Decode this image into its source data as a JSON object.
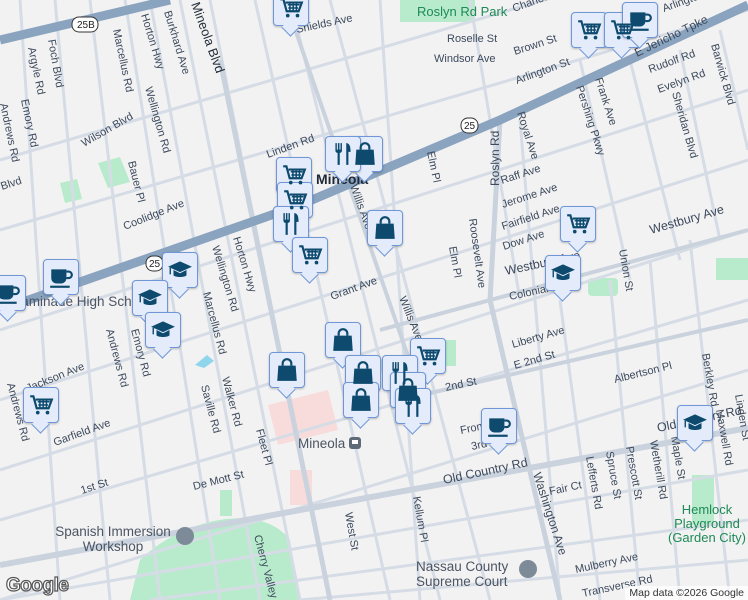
{
  "map": {
    "area_labels": {
      "mineola": "Mineola",
      "mineola_station": "Mineola"
    },
    "parks": [
      "Roslyn Rd Park",
      "Hemlock Playground (Garden City)"
    ],
    "pois": [
      "Chaminade High School",
      "Spanish Immersion Workshop",
      "Nassau County Supreme Court"
    ],
    "route_shields": [
      "25B",
      "25",
      "25",
      "25"
    ],
    "streets": [
      "Foch Blvd",
      "Argyle Rd",
      "Emory Rd",
      "Andrews Rd",
      "Marcellus Rd",
      "Horton Hwy",
      "Burkhard Ave",
      "Mineola Blvd",
      "Wellington Rd",
      "Wilson Blvd",
      "Bauer Pl",
      "Coolidge Ave",
      "Linden Rd",
      "Shields Ave",
      "Roselle St",
      "Windsor Ave",
      "Brown St",
      "Arlington St",
      "E Jericho Tpke",
      "Rudolf Rd",
      "Evelyn Rd",
      "Barwick Blvd",
      "Sheridan Blvd",
      "Frank Ave",
      "Pershing Pkwy",
      "Royal Ave",
      "Elm Pl",
      "Roslyn Rd",
      "Raff Ave",
      "Jerome Ave",
      "Fairfield Ave",
      "Dow Ave",
      "Westbury Ave",
      "Westbury Ave",
      "Union St",
      "Roosevelt Ave",
      "Colonial",
      "Willis Ave",
      "Grant Ave",
      "Willis Ave",
      "Liberty Ave",
      "E 2nd St",
      "2nd St",
      "Albertson Pl",
      "Front St",
      "3rd",
      "Old Country Rd",
      "Old Country Rd",
      "Washington Ave",
      "Fair Ct",
      "Lefferts Rd",
      "Spruce St",
      "Prescott St",
      "Wetherill Rd",
      "Maple St",
      "Berkley Rd",
      "Maxwell Rd",
      "Linden St",
      "Mulberry Ave",
      "Transverse Rd",
      "Kellum Pl",
      "West St",
      "Cherry Valley",
      "Jackson Ave",
      "Garfield Ave",
      "1st St",
      "De Mott St",
      "Saville Rd",
      "Walker Rd",
      "Fleet Pl",
      "Horton Hwy",
      "Wellington Rd",
      "Emory Rd",
      "Andrews Rd",
      "Arlington",
      "Charles",
      "Elm Pl",
      "Marcellus Rd",
      "Andrews Rd",
      "Blvd",
      "Rd",
      "Rd",
      "Ave",
      "Rd"
    ],
    "attribution": "Map data ©2026 Google",
    "logo": "Google"
  },
  "markers": [
    {
      "type": "grocery",
      "icon": "cart-icon"
    },
    {
      "type": "grocery",
      "icon": "cart-icon"
    },
    {
      "type": "grocery",
      "icon": "cart-icon"
    },
    {
      "type": "cafe",
      "icon": "coffee-cup-icon"
    },
    {
      "type": "store",
      "icon": "shopping-bag-icon"
    },
    {
      "type": "restaurant",
      "icon": "fork-knife-icon"
    },
    {
      "type": "grocery",
      "icon": "cart-icon"
    },
    {
      "type": "grocery",
      "icon": "cart-icon"
    },
    {
      "type": "restaurant",
      "icon": "fork-knife-icon"
    },
    {
      "type": "grocery",
      "icon": "cart-icon"
    },
    {
      "type": "store",
      "icon": "shopping-bag-icon"
    },
    {
      "type": "grocery",
      "icon": "cart-icon"
    },
    {
      "type": "school",
      "icon": "graduation-cap-icon"
    },
    {
      "type": "cafe",
      "icon": "coffee-cup-icon"
    },
    {
      "type": "cafe",
      "icon": "coffee-cup-icon"
    },
    {
      "type": "school",
      "icon": "graduation-cap-icon"
    },
    {
      "type": "school",
      "icon": "graduation-cap-icon"
    },
    {
      "type": "school",
      "icon": "graduation-cap-icon"
    },
    {
      "type": "store",
      "icon": "shopping-bag-icon"
    },
    {
      "type": "store",
      "icon": "shopping-bag-icon"
    },
    {
      "type": "grocery",
      "icon": "cart-icon"
    },
    {
      "type": "restaurant",
      "icon": "fork-knife-icon"
    },
    {
      "type": "store",
      "icon": "shopping-bag-icon"
    },
    {
      "type": "store",
      "icon": "shopping-bag-icon"
    },
    {
      "type": "store",
      "icon": "shopping-bag-icon"
    },
    {
      "type": "restaurant",
      "icon": "fork-knife-icon"
    },
    {
      "type": "grocery",
      "icon": "cart-icon"
    },
    {
      "type": "cafe",
      "icon": "coffee-cup-icon"
    },
    {
      "type": "school",
      "icon": "graduation-cap-icon"
    }
  ],
  "colors": {
    "highway": "#8aa3bf",
    "road": "#d5dce5",
    "park": "#b8ebcb",
    "land": "#f3f2f3",
    "marker_fill": "#e4ecfb",
    "marker_icon": "#0d4a6e"
  }
}
